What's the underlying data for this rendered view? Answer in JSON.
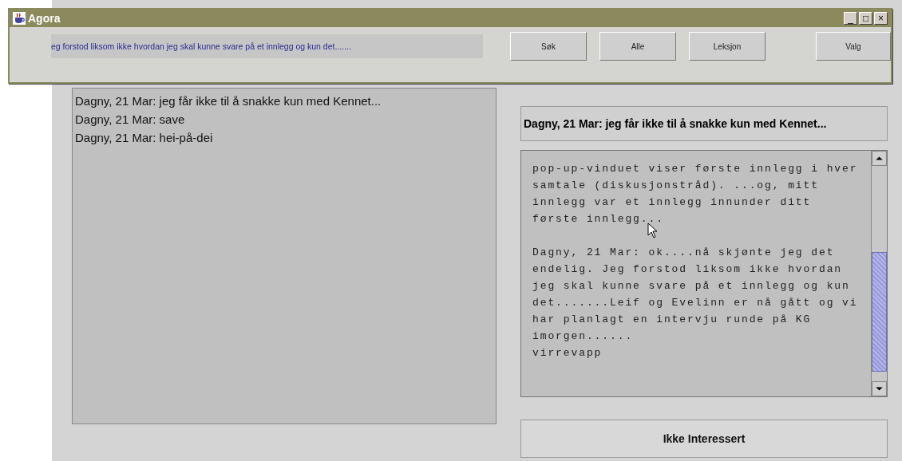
{
  "window": {
    "title": "Agora",
    "controls": [
      "_",
      "□",
      "×"
    ]
  },
  "ticker": "eg forstod liksom ikke hvordan jeg skal kunne svare på et innlegg og kun det.......",
  "toolbar_buttons": [
    "Søk",
    "Alle",
    "Leksjon",
    "Valg"
  ],
  "messages": [
    {
      "text": "Dagny, 21 Mar: jeg får ikke til å snakke kun med Kennet...",
      "selected": false
    },
    {
      "text": "Dagny, 21 Mar: save",
      "selected": false
    },
    {
      "text": "Dagny, 21 Mar: hei-på-dei",
      "selected": false
    }
  ],
  "message_title": "Dagny, 21 Mar: jeg får ikke til å snakke kun med Kennet...",
  "message_body": [
    [
      "pop-up-vinduet viser første innlegg i hver",
      "samtale (diskusjonstråd). ...og, mitt",
      "innlegg var et innlegg innunder ditt",
      "første innlegg..."
    ],
    [
      "Dagny, 21 Mar: ok....nå skjønte jeg det",
      "endelig. Jeg forstod liksom ikke hvordan",
      "jeg skal kunne svare på et innlegg og kun",
      "det.......Leif og Evelinn er nå gått og vi",
      "har planlagt en intervju runde på KG",
      "imorgen......",
      "virrevapp"
    ]
  ],
  "action_button": "Ikke Interessert"
}
